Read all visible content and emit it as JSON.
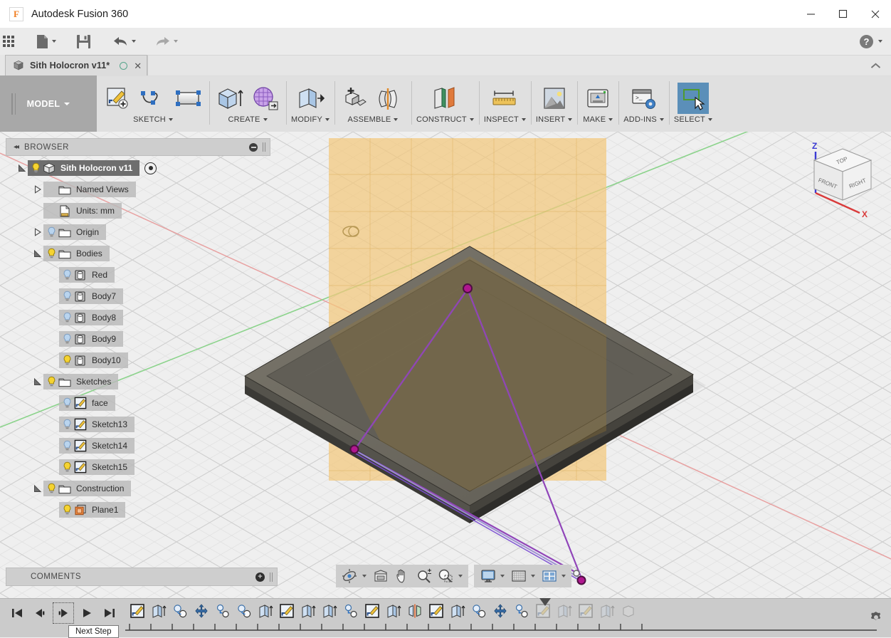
{
  "window": {
    "app_title": "Autodesk Fusion 360",
    "logo_letter": "F",
    "minimize": "minimize-button",
    "maximize": "maximize-button",
    "close": "close-button"
  },
  "quick_access": {
    "items": [
      {
        "name": "app-grid-icon",
        "label": "Show Data Panel"
      },
      {
        "name": "file-icon",
        "label": "File"
      },
      {
        "name": "save-icon",
        "label": "Save"
      },
      {
        "name": "undo-icon",
        "label": "Undo"
      },
      {
        "name": "redo-icon",
        "label": "Redo"
      }
    ],
    "help_label": "?"
  },
  "tabs": {
    "active": {
      "title": "Sith Holocron v11*",
      "close_label": "✕"
    },
    "collapse_chevron": "⌃"
  },
  "ribbon": {
    "workspace": {
      "label": "MODEL"
    },
    "groups": [
      {
        "label": "SKETCH",
        "icons": [
          "create-sketch-icon",
          "spline-icon",
          "rectangle-icon"
        ]
      },
      {
        "label": "CREATE",
        "icons": [
          "extrude-icon",
          "create-form-icon"
        ]
      },
      {
        "label": "MODIFY",
        "icons": [
          "press-pull-icon"
        ]
      },
      {
        "label": "ASSEMBLE",
        "icons": [
          "new-component-icon",
          "joint-icon"
        ]
      },
      {
        "label": "CONSTRUCT",
        "icons": [
          "offset-plane-icon"
        ]
      },
      {
        "label": "INSPECT",
        "icons": [
          "measure-icon"
        ]
      },
      {
        "label": "INSERT",
        "icons": [
          "insert-image-icon"
        ]
      },
      {
        "label": "MAKE",
        "icons": [
          "3d-print-icon"
        ]
      },
      {
        "label": "ADD-INS",
        "icons": [
          "scripts-addins-icon"
        ]
      },
      {
        "label": "SELECT",
        "icons": [
          "select-window-icon"
        ],
        "active": true
      }
    ]
  },
  "browser": {
    "header": {
      "title": "BROWSER",
      "collapse_icon": "◂◂",
      "minimize_icon": "minimize-panel-icon"
    },
    "tree": [
      {
        "label": "Sith Holocron v11",
        "icon": "component-icon",
        "indent": 0,
        "twisty": "open",
        "bulb": "on",
        "selected": true,
        "radio": true
      },
      {
        "label": "Named Views",
        "icon": "folder-icon",
        "indent": 1,
        "twisty": "closed",
        "bulb": "none",
        "selected": false
      },
      {
        "label": "Units: mm",
        "icon": "units-icon",
        "indent": 1,
        "twisty": "none",
        "bulb": "none",
        "selected": false
      },
      {
        "label": "Origin",
        "icon": "folder-icon",
        "indent": 1,
        "twisty": "closed",
        "bulb": "off",
        "selected": false
      },
      {
        "label": "Bodies",
        "icon": "folder-icon",
        "indent": 1,
        "twisty": "open",
        "bulb": "on",
        "selected": false
      },
      {
        "label": "Red",
        "icon": "body-icon",
        "indent": 2,
        "twisty": "none",
        "bulb": "off",
        "selected": false
      },
      {
        "label": "Body7",
        "icon": "body-icon",
        "indent": 2,
        "twisty": "none",
        "bulb": "off",
        "selected": false
      },
      {
        "label": "Body8",
        "icon": "body-icon",
        "indent": 2,
        "twisty": "none",
        "bulb": "off",
        "selected": false
      },
      {
        "label": "Body9",
        "icon": "body-icon",
        "indent": 2,
        "twisty": "none",
        "bulb": "off",
        "selected": false
      },
      {
        "label": "Body10",
        "icon": "body-icon",
        "indent": 2,
        "twisty": "none",
        "bulb": "on",
        "selected": false
      },
      {
        "label": "Sketches",
        "icon": "folder-icon",
        "indent": 1,
        "twisty": "open",
        "bulb": "on",
        "selected": false
      },
      {
        "label": "face",
        "icon": "sketch-icon",
        "indent": 2,
        "twisty": "none",
        "bulb": "off",
        "selected": false
      },
      {
        "label": "Sketch13",
        "icon": "sketch-icon",
        "indent": 2,
        "twisty": "none",
        "bulb": "off",
        "selected": false
      },
      {
        "label": "Sketch14",
        "icon": "sketch-icon",
        "indent": 2,
        "twisty": "none",
        "bulb": "off",
        "selected": false
      },
      {
        "label": "Sketch15",
        "icon": "sketch-icon",
        "indent": 2,
        "twisty": "none",
        "bulb": "on",
        "selected": false
      },
      {
        "label": "Construction",
        "icon": "folder-icon",
        "indent": 1,
        "twisty": "open",
        "bulb": "on",
        "selected": false
      },
      {
        "label": "Plane1",
        "icon": "plane-icon",
        "indent": 2,
        "twisty": "none",
        "bulb": "on",
        "selected": false
      }
    ]
  },
  "comments": {
    "title": "COMMENTS",
    "add_label": "+"
  },
  "navbar": {
    "group1": [
      "orbit-icon",
      "look-at-icon",
      "pan-icon",
      "zoom-icon",
      "zoom-window-icon"
    ],
    "group2": [
      "display-settings-icon",
      "grid-snap-icon",
      "viewports-icon"
    ]
  },
  "viewcube": {
    "faces": {
      "top": "TOP",
      "front": "FRONT",
      "right": "RIGHT"
    },
    "axes": {
      "z": "Z",
      "x": "X"
    },
    "z_color": "#3b3bd4",
    "x_color": "#d93b3b"
  },
  "viewport": {
    "plane_color": "#f2c777",
    "sketch_color": "#7b4fd0",
    "point_color": "#b0178f",
    "body_top_color": "#6e6a60",
    "body_side_color": "#4a4843",
    "x_axis_color": "#e06666",
    "y_axis_color": "#5fc45f",
    "grid_color": "#d8d8d8"
  },
  "timeline": {
    "playback": [
      "go-to-beginning-icon",
      "step-back-icon",
      "step-forward-icon",
      "play-icon",
      "go-to-end-icon"
    ],
    "features": [
      {
        "icon": "sketch-icon",
        "state": "done"
      },
      {
        "icon": "extrude-icon",
        "state": "done"
      },
      {
        "icon": "combine-icon",
        "state": "done"
      },
      {
        "icon": "move-icon",
        "state": "done"
      },
      {
        "icon": "shell-icon",
        "state": "done"
      },
      {
        "icon": "combine-icon",
        "state": "done"
      },
      {
        "icon": "extrude-icon",
        "state": "done"
      },
      {
        "icon": "sketch-icon",
        "state": "done"
      },
      {
        "icon": "extrude-icon",
        "state": "done"
      },
      {
        "icon": "extrude-icon",
        "state": "done"
      },
      {
        "icon": "shell-icon",
        "state": "done"
      },
      {
        "icon": "sketch-icon",
        "state": "done"
      },
      {
        "icon": "extrude-icon",
        "state": "done"
      },
      {
        "icon": "mirror-icon",
        "state": "done"
      },
      {
        "icon": "sketch-icon",
        "state": "done"
      },
      {
        "icon": "extrude-icon",
        "state": "done"
      },
      {
        "icon": "combine-icon",
        "state": "done"
      },
      {
        "icon": "move-icon",
        "state": "done"
      },
      {
        "icon": "shell-icon",
        "state": "done"
      },
      {
        "icon": "sketch-icon",
        "state": "pending"
      },
      {
        "icon": "extrude-icon",
        "state": "pending"
      },
      {
        "icon": "sketch-icon",
        "state": "pending"
      },
      {
        "icon": "extrude-icon",
        "state": "pending"
      },
      {
        "icon": "body-icon",
        "state": "pending"
      }
    ],
    "marker_index": 19,
    "settings_label": "settings-gear-icon",
    "tooltip": "Next Step"
  }
}
